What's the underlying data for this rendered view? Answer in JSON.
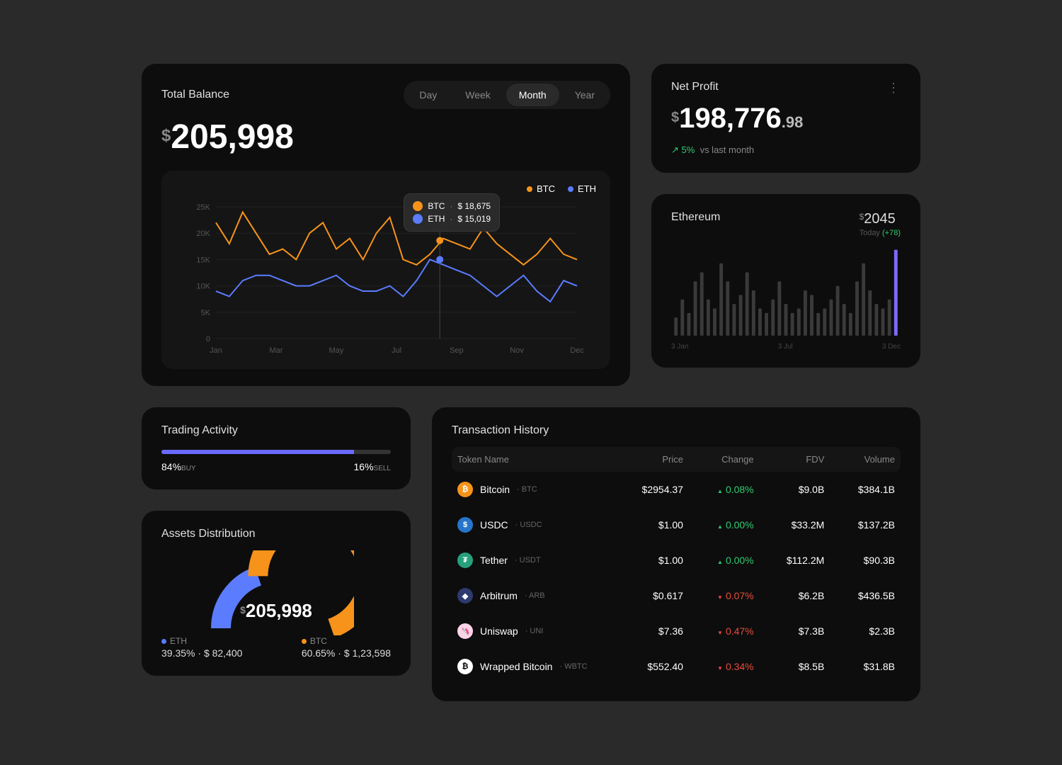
{
  "balance": {
    "title": "Total Balance",
    "currency": "$",
    "amount": "205,998",
    "periods": [
      "Day",
      "Week",
      "Month",
      "Year"
    ],
    "active_period": "Month",
    "legend_btc": "BTC",
    "legend_eth": "ETH",
    "y_ticks": [
      "25K",
      "20K",
      "15K",
      "10K",
      "5K",
      "0"
    ],
    "x_ticks": [
      "Jan",
      "Mar",
      "May",
      "Jul",
      "Sep",
      "Nov",
      "Dec"
    ],
    "tooltip": {
      "btc_label": "BTC",
      "btc_value": "$ 18,675",
      "eth_label": "ETH",
      "eth_value": "$ 15,019"
    }
  },
  "netprofit": {
    "title": "Net Profit",
    "currency": "$",
    "amount": "198,776",
    "cents": ".98",
    "trend_icon": "↗",
    "trend_pct": "5%",
    "trend_label": "vs last month"
  },
  "ethereum": {
    "title": "Ethereum",
    "currency": "$",
    "price": "2045",
    "today_label": "Today",
    "today_change": "(+78)",
    "x_ticks": [
      "3 Jan",
      "3 Jul",
      "3 Dec"
    ]
  },
  "trading": {
    "title": "Trading Activity",
    "buy_pct": "84%",
    "buy_label": "BUY",
    "sell_pct": "16%",
    "sell_label": "SELL"
  },
  "assets": {
    "title": "Assets Distribution",
    "currency": "$",
    "amount": "205,998",
    "eth": {
      "label": "ETH",
      "pct": "39.35%",
      "value": "$ 82,400"
    },
    "btc": {
      "label": "BTC",
      "pct": "60.65%",
      "value": "$ 1,23,598"
    }
  },
  "transactions": {
    "title": "Transaction History",
    "columns": [
      "Token Name",
      "Price",
      "Change",
      "FDV",
      "Volume"
    ],
    "rows": [
      {
        "icon_color": "#f7931a",
        "icon_letter": "₿",
        "name": "Bitcoin",
        "symbol": "BTC",
        "price": "$2954.37",
        "change": "0.08%",
        "dir": "up",
        "fdv": "$9.0B",
        "volume": "$384.1B"
      },
      {
        "icon_color": "#2775ca",
        "icon_letter": "$",
        "name": "USDC",
        "symbol": "USDC",
        "price": "$1.00",
        "change": "0.00%",
        "dir": "up",
        "fdv": "$33.2M",
        "volume": "$137.2B"
      },
      {
        "icon_color": "#26a17b",
        "icon_letter": "₮",
        "name": "Tether",
        "symbol": "USDT",
        "price": "$1.00",
        "change": "0.00%",
        "dir": "up",
        "fdv": "$112.2M",
        "volume": "$90.3B"
      },
      {
        "icon_color": "#2d3a6e",
        "icon_letter": "◆",
        "name": "Arbitrum",
        "symbol": "ARB",
        "price": "$0.617",
        "change": "0.07%",
        "dir": "down",
        "fdv": "$6.2B",
        "volume": "$436.5B"
      },
      {
        "icon_color": "#ffd4e9",
        "icon_letter": "🦄",
        "name": "Uniswap",
        "symbol": "UNI",
        "price": "$7.36",
        "change": "0.47%",
        "dir": "down",
        "fdv": "$7.3B",
        "volume": "$2.3B"
      },
      {
        "icon_color": "#ffffff",
        "icon_letter": "₿",
        "name": "Wrapped Bitcoin",
        "symbol": "WBTC",
        "price": "$552.40",
        "change": "0.34%",
        "dir": "down",
        "fdv": "$8.5B",
        "volume": "$31.8B"
      }
    ]
  },
  "chart_data": [
    {
      "type": "line",
      "title": "Total Balance",
      "xlabel": "",
      "ylabel": "",
      "x_ticks": [
        "Jan",
        "Mar",
        "May",
        "Jul",
        "Sep",
        "Nov",
        "Dec"
      ],
      "ylim": [
        0,
        25
      ],
      "series": [
        {
          "name": "BTC",
          "color": "#f7931a",
          "values": [
            22,
            18,
            24,
            20,
            16,
            17,
            15,
            20,
            22,
            17,
            19,
            15,
            20,
            23,
            15,
            14,
            16,
            19,
            18,
            17,
            21,
            18,
            16,
            14,
            16,
            19,
            16,
            15
          ]
        },
        {
          "name": "ETH",
          "color": "#5b7cff",
          "values": [
            9,
            8,
            11,
            12,
            12,
            11,
            10,
            10,
            11,
            12,
            10,
            9,
            9,
            10,
            8,
            11,
            15,
            14,
            13,
            12,
            10,
            8,
            10,
            12,
            9,
            7,
            11,
            10
          ]
        }
      ]
    },
    {
      "type": "bar",
      "title": "Ethereum",
      "categories": [
        "3 Jan",
        "",
        "",
        "",
        "",
        "",
        "",
        "",
        "",
        "",
        "",
        "",
        "",
        "",
        "",
        "",
        "",
        "3 Jul",
        "",
        "",
        "",
        "",
        "",
        "",
        "",
        "",
        "",
        "",
        "",
        "",
        "",
        "",
        "",
        "",
        "3 Dec"
      ],
      "values": [
        20,
        40,
        25,
        60,
        70,
        40,
        30,
        80,
        60,
        35,
        45,
        70,
        50,
        30,
        25,
        40,
        60,
        35,
        25,
        30,
        50,
        45,
        25,
        30,
        40,
        55,
        35,
        25,
        60,
        80,
        50,
        35,
        30,
        40,
        95
      ],
      "highlight_index": 34,
      "highlight_color": "#7b6aff",
      "ylim": [
        0,
        100
      ]
    },
    {
      "type": "pie",
      "title": "Assets Distribution",
      "series": [
        {
          "name": "ETH",
          "value": 39.35,
          "color": "#5b7cff"
        },
        {
          "name": "BTC",
          "value": 60.65,
          "color": "#f7931a"
        }
      ]
    }
  ]
}
